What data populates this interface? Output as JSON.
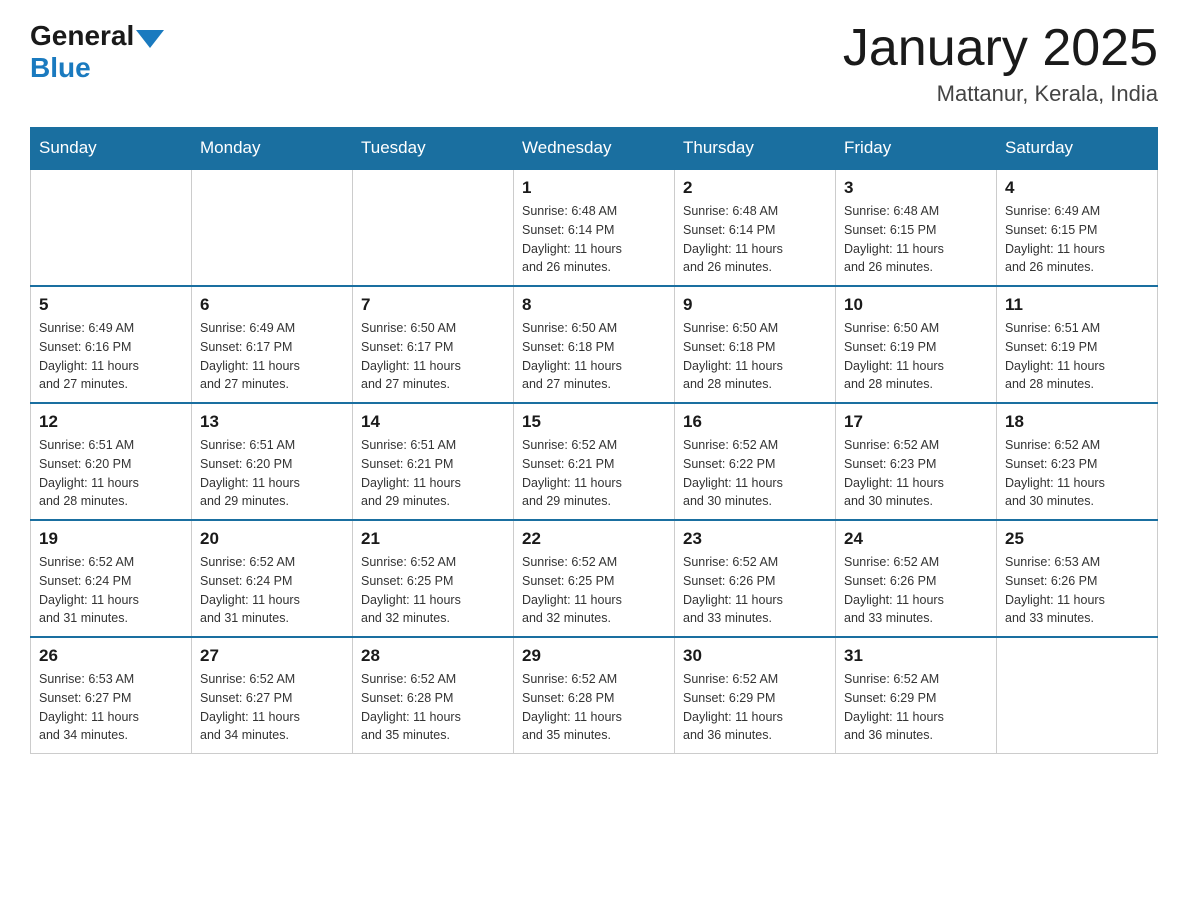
{
  "header": {
    "logo_general": "General",
    "logo_blue": "Blue",
    "month_title": "January 2025",
    "location": "Mattanur, Kerala, India"
  },
  "weekdays": [
    "Sunday",
    "Monday",
    "Tuesday",
    "Wednesday",
    "Thursday",
    "Friday",
    "Saturday"
  ],
  "weeks": [
    {
      "days": [
        {
          "number": "",
          "info": ""
        },
        {
          "number": "",
          "info": ""
        },
        {
          "number": "",
          "info": ""
        },
        {
          "number": "1",
          "info": "Sunrise: 6:48 AM\nSunset: 6:14 PM\nDaylight: 11 hours\nand 26 minutes."
        },
        {
          "number": "2",
          "info": "Sunrise: 6:48 AM\nSunset: 6:14 PM\nDaylight: 11 hours\nand 26 minutes."
        },
        {
          "number": "3",
          "info": "Sunrise: 6:48 AM\nSunset: 6:15 PM\nDaylight: 11 hours\nand 26 minutes."
        },
        {
          "number": "4",
          "info": "Sunrise: 6:49 AM\nSunset: 6:15 PM\nDaylight: 11 hours\nand 26 minutes."
        }
      ]
    },
    {
      "days": [
        {
          "number": "5",
          "info": "Sunrise: 6:49 AM\nSunset: 6:16 PM\nDaylight: 11 hours\nand 27 minutes."
        },
        {
          "number": "6",
          "info": "Sunrise: 6:49 AM\nSunset: 6:17 PM\nDaylight: 11 hours\nand 27 minutes."
        },
        {
          "number": "7",
          "info": "Sunrise: 6:50 AM\nSunset: 6:17 PM\nDaylight: 11 hours\nand 27 minutes."
        },
        {
          "number": "8",
          "info": "Sunrise: 6:50 AM\nSunset: 6:18 PM\nDaylight: 11 hours\nand 27 minutes."
        },
        {
          "number": "9",
          "info": "Sunrise: 6:50 AM\nSunset: 6:18 PM\nDaylight: 11 hours\nand 28 minutes."
        },
        {
          "number": "10",
          "info": "Sunrise: 6:50 AM\nSunset: 6:19 PM\nDaylight: 11 hours\nand 28 minutes."
        },
        {
          "number": "11",
          "info": "Sunrise: 6:51 AM\nSunset: 6:19 PM\nDaylight: 11 hours\nand 28 minutes."
        }
      ]
    },
    {
      "days": [
        {
          "number": "12",
          "info": "Sunrise: 6:51 AM\nSunset: 6:20 PM\nDaylight: 11 hours\nand 28 minutes."
        },
        {
          "number": "13",
          "info": "Sunrise: 6:51 AM\nSunset: 6:20 PM\nDaylight: 11 hours\nand 29 minutes."
        },
        {
          "number": "14",
          "info": "Sunrise: 6:51 AM\nSunset: 6:21 PM\nDaylight: 11 hours\nand 29 minutes."
        },
        {
          "number": "15",
          "info": "Sunrise: 6:52 AM\nSunset: 6:21 PM\nDaylight: 11 hours\nand 29 minutes."
        },
        {
          "number": "16",
          "info": "Sunrise: 6:52 AM\nSunset: 6:22 PM\nDaylight: 11 hours\nand 30 minutes."
        },
        {
          "number": "17",
          "info": "Sunrise: 6:52 AM\nSunset: 6:23 PM\nDaylight: 11 hours\nand 30 minutes."
        },
        {
          "number": "18",
          "info": "Sunrise: 6:52 AM\nSunset: 6:23 PM\nDaylight: 11 hours\nand 30 minutes."
        }
      ]
    },
    {
      "days": [
        {
          "number": "19",
          "info": "Sunrise: 6:52 AM\nSunset: 6:24 PM\nDaylight: 11 hours\nand 31 minutes."
        },
        {
          "number": "20",
          "info": "Sunrise: 6:52 AM\nSunset: 6:24 PM\nDaylight: 11 hours\nand 31 minutes."
        },
        {
          "number": "21",
          "info": "Sunrise: 6:52 AM\nSunset: 6:25 PM\nDaylight: 11 hours\nand 32 minutes."
        },
        {
          "number": "22",
          "info": "Sunrise: 6:52 AM\nSunset: 6:25 PM\nDaylight: 11 hours\nand 32 minutes."
        },
        {
          "number": "23",
          "info": "Sunrise: 6:52 AM\nSunset: 6:26 PM\nDaylight: 11 hours\nand 33 minutes."
        },
        {
          "number": "24",
          "info": "Sunrise: 6:52 AM\nSunset: 6:26 PM\nDaylight: 11 hours\nand 33 minutes."
        },
        {
          "number": "25",
          "info": "Sunrise: 6:53 AM\nSunset: 6:26 PM\nDaylight: 11 hours\nand 33 minutes."
        }
      ]
    },
    {
      "days": [
        {
          "number": "26",
          "info": "Sunrise: 6:53 AM\nSunset: 6:27 PM\nDaylight: 11 hours\nand 34 minutes."
        },
        {
          "number": "27",
          "info": "Sunrise: 6:52 AM\nSunset: 6:27 PM\nDaylight: 11 hours\nand 34 minutes."
        },
        {
          "number": "28",
          "info": "Sunrise: 6:52 AM\nSunset: 6:28 PM\nDaylight: 11 hours\nand 35 minutes."
        },
        {
          "number": "29",
          "info": "Sunrise: 6:52 AM\nSunset: 6:28 PM\nDaylight: 11 hours\nand 35 minutes."
        },
        {
          "number": "30",
          "info": "Sunrise: 6:52 AM\nSunset: 6:29 PM\nDaylight: 11 hours\nand 36 minutes."
        },
        {
          "number": "31",
          "info": "Sunrise: 6:52 AM\nSunset: 6:29 PM\nDaylight: 11 hours\nand 36 minutes."
        },
        {
          "number": "",
          "info": ""
        }
      ]
    }
  ]
}
